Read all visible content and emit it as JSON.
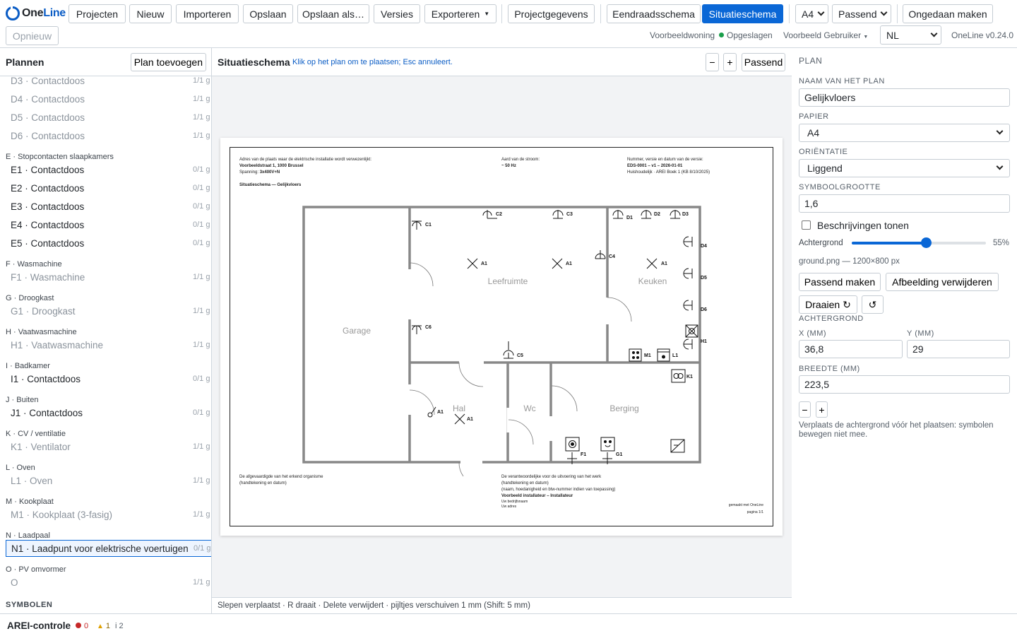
{
  "app": {
    "logo_prefix": "One",
    "logo_suffix": "Line",
    "version": "OneLine v0.24.0"
  },
  "toolbar": {
    "projects": "Projecten",
    "new": "Nieuw",
    "import": "Importeren",
    "save": "Opslaan",
    "save_as": "Opslaan als…",
    "versions": "Versies",
    "export": "Exporteren",
    "project_data": "Projectgegevens",
    "single_line": "Eendraadsschema",
    "site_plan": "Situatieschema",
    "paper": "A4",
    "fit": "Passend",
    "undo": "Ongedaan maken",
    "redo": "Opnieuw"
  },
  "meta": {
    "project": "Voorbeeldwoning",
    "status": "Opgeslagen",
    "user": "Voorbeeld Gebruiker",
    "language": "NL"
  },
  "plans": {
    "title": "Plannen",
    "add_label": "Plan toevoegen",
    "items": [
      {
        "label": "D3 · Contactdoos",
        "count": "1/1 g"
      },
      {
        "label": "D4 · Contactdoos",
        "count": "1/1 g"
      },
      {
        "label": "D5 · Contactdoos",
        "count": "1/1 g"
      },
      {
        "label": "D6 · Contactdoos",
        "count": "1/1 g"
      },
      {
        "group": "E · Stopcontacten slaapkamers"
      },
      {
        "label": "E1 · Contactdoos",
        "count": "0/1 g"
      },
      {
        "label": "E2 · Contactdoos",
        "count": "0/1 g"
      },
      {
        "label": "E3 · Contactdoos",
        "count": "0/1 g"
      },
      {
        "label": "E4 · Contactdoos",
        "count": "0/1 g"
      },
      {
        "label": "E5 · Contactdoos",
        "count": "0/1 g"
      },
      {
        "group": "F · Wasmachine"
      },
      {
        "label": "F1 · Wasmachine",
        "count": "1/1 g"
      },
      {
        "group": "G · Droogkast"
      },
      {
        "label": "G1 · Droogkast",
        "count": "1/1 g"
      },
      {
        "group": "H · Vaatwasmachine"
      },
      {
        "label": "H1 · Vaatwasmachine",
        "count": "1/1 g"
      },
      {
        "group": "I · Badkamer"
      },
      {
        "label": "I1 · Contactdoos",
        "count": "0/1 g"
      },
      {
        "group": "J · Buiten"
      },
      {
        "label": "J1 · Contactdoos",
        "count": "0/1 g"
      },
      {
        "group": "K · CV / ventilatie"
      },
      {
        "label": "K1 · Ventilator",
        "count": "1/1 g"
      },
      {
        "group": "L · Oven"
      },
      {
        "label": "L1 · Oven",
        "count": "1/1 g"
      },
      {
        "group": "M · Kookplaat"
      },
      {
        "label": "M1 · Kookplaat (3-fasig)",
        "count": "1/1 g"
      },
      {
        "group": "N · Laadpaal"
      },
      {
        "label": "N1 · Laadpunt voor elektrische voertuigen",
        "count": "0/1 g"
      },
      {
        "group": "O · PV omvormer"
      },
      {
        "label": "O",
        "count": "1/1 g"
      }
    ],
    "symbols_heading": "SYMBOLEN"
  },
  "center": {
    "title": "Situatieschema",
    "hint": "Klik op het plan om te plaatsen; Esc annuleert.",
    "zoom_out": "−",
    "zoom_in": "+",
    "fit": "Passend",
    "status": "Slepen verplaatst · R draait · Delete verwijdert · pijltjes verschuiven 1 mm (Shift: 5 mm)"
  },
  "sheet": {
    "addr_label": "Adres van de plaats waar de elektrische installatie wordt verwezenlijkt:",
    "addr": "Voorbeeldstraat 1, 1000 Brussel",
    "voltage_label": "Spanning:",
    "voltage": "3x400V+N",
    "plan_title": "Situatieschema — Gelijkvloers",
    "current_label": "Aard van de stroom:",
    "current": "~ 50 Hz",
    "doc_label": "Nummer, versie en datum van de versie:",
    "doc": "EDS-0001 – v1 – 2026-01-01",
    "doc_sub": "Huishoudelijk · AREI Boek 1 (KB 8/10/2025)",
    "sign_left_1": "De afgevaardigde van het erkend organisme",
    "sign_left_2": "(handtekening en datum)",
    "sign_right_1": "De verantwoordelijke voor de uitvoering van het werk",
    "sign_right_2": "(handtekening en datum)",
    "sign_right_3": "(naam, hoedanigheid en btw-nummer indien van toepassing)",
    "installer": "Voorbeeld installateur – Installateur",
    "company": "Uw bedrijfsnaam",
    "company_addr": "Uw adres",
    "made_with": "gemaakt met OneLine",
    "page": "pagina 1/1",
    "rooms": {
      "living": "Leefruimte",
      "kitchen": "Keuken",
      "garage": "Garage",
      "hall": "Hal",
      "wc": "Wc",
      "storage": "Berging"
    },
    "labels": {
      "c1": "C1",
      "c2": "C2",
      "c3": "C3",
      "c4": "C4",
      "c5": "C5",
      "c6": "C6",
      "d1": "D1",
      "d2": "D2",
      "d3": "D3",
      "d4": "D4",
      "d5": "D5",
      "d6": "D6",
      "a1": "A1",
      "h1": "H1",
      "m1": "M1",
      "l1": "L1",
      "k1": "K1",
      "f1": "F1",
      "g1": "G1"
    }
  },
  "props": {
    "section": "PLAN",
    "name_label": "NAAM VAN HET PLAN",
    "name_value": "Gelijkvloers",
    "paper_label": "PAPIER",
    "paper_value": "A4",
    "orientation_label": "ORIËNTATIE",
    "orientation_value": "Liggend",
    "symbol_label": "SYMBOOLGROOTTE",
    "symbol_value": "1,6",
    "descriptions_label": "Beschrijvingen tonen",
    "background_label": "Achtergrond",
    "background_pct": "55%",
    "background_level": 0.55,
    "file": "ground.png — 1200×800 px",
    "fit_btn": "Passend maken",
    "remove_btn": "Afbeelding verwijderen",
    "rotate_btn": "Draaien",
    "bg_section": "ACHTERGROND",
    "x_label": "X (MM)",
    "x_value": "36,8",
    "y_label": "Y (MM)",
    "y_value": "29",
    "width_label": "BREEDTE (MM)",
    "width_value": "223,5",
    "minus": "−",
    "plus": "+",
    "note": "Verplaats de achtergrond vóór het plaatsen: symbolen bewegen niet mee."
  },
  "footer": {
    "title": "AREI-controle",
    "errors": "0",
    "warnings": "1",
    "info": "i 2"
  },
  "colors": {
    "accent": "#0a67d6",
    "ok": "#1a9e4a",
    "error": "#c62828",
    "warning": "#e0a000"
  }
}
